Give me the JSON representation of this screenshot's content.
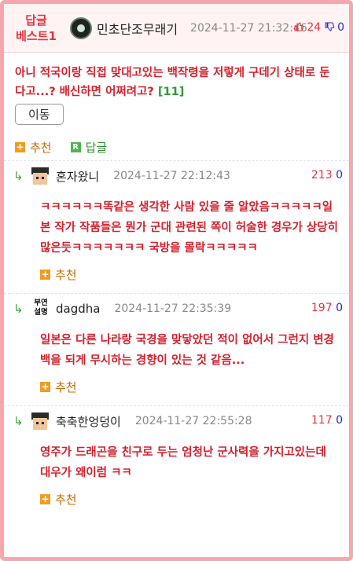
{
  "main": {
    "badge": [
      "답글",
      "베스트1"
    ],
    "author": "민초단조무래기",
    "date": "2024-11-27 21:32:46",
    "votes_up": "24",
    "votes_down": "0",
    "text": "아니 적국이랑 직접 맞대고있는 백작령을 저렇게 구데기 상태로 둔다고...? 배신하면 어쩌려고?",
    "reply_count": "[11]",
    "move_label": "이동",
    "recommend_label": "추천",
    "reply_label": "답글"
  },
  "replies": [
    {
      "author": "혼자왔니",
      "date": "2024-11-27 22:12:43",
      "votes_up": "213",
      "votes_down": "0",
      "text": "ㅋㅋㅋㅋㅋㅋ똑같은 생각한 사람 있을 줄 알았음ㅋㅋㅋㅋㅋ일본 작가 작품들은 뭔가 군대 관련된 쪽이 허술한 경우가 상당히 많은듯ㅋㅋㅋㅋㅋㅋㅋ 국방을 몰락ㅋㅋㅋㅋㅋ",
      "recommend_label": "추천",
      "avatar_icon": "pixel-face-icon"
    },
    {
      "author": "dagdha",
      "avatar_text": [
        "부연",
        "설명"
      ],
      "date": "2024-11-27 22:35:39",
      "votes_up": "197",
      "votes_down": "0",
      "text": "일본은 다른 나라랑 국경을 맞닿았던 적이 없어서 그런지 변경백을 되게 무시하는 경향이 있는 것 같음...",
      "recommend_label": "추천"
    },
    {
      "author": "축축한엉덩이",
      "date": "2024-11-27 22:55:28",
      "votes_up": "117",
      "votes_down": "0",
      "text": "영주가 드래곤을 친구로 두는 엄청난 군사력을 가지고있는데 대우가 왜이럼 ㅋㅋ",
      "recommend_label": "추천",
      "avatar_icon": "pixel-face-icon"
    }
  ],
  "colors": {
    "border": "#f5a7ad",
    "header_bg": "#fff3f4",
    "text_red": "#d4202c",
    "vote_up": "#e6343f",
    "vote_down": "#2a2acb",
    "count_green": "#2e9a33",
    "plus_orange": "#f29b1f"
  }
}
